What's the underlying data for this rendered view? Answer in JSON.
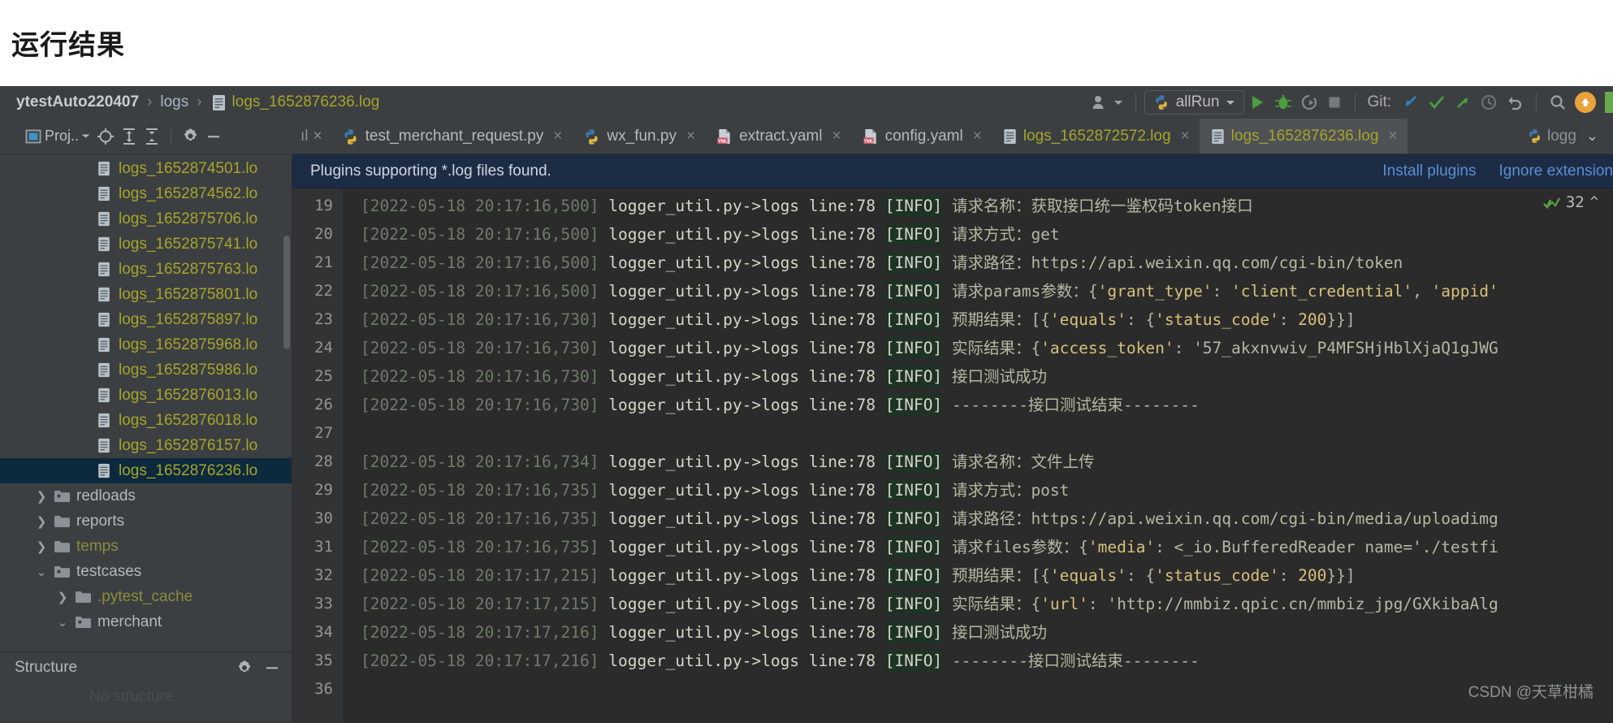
{
  "page": {
    "heading": "运行结果"
  },
  "breadcrumb": {
    "project": "ytestAuto220407",
    "folder": "logs",
    "file": "logs_1652876236.log",
    "separator": "›"
  },
  "toolbar": {
    "user_icon": "user-icon",
    "run_config": "allRun",
    "run_icon": "run-icon",
    "debug_icon": "debug-icon",
    "coverage_icon": "coverage-run-icon",
    "stop_icon": "stop-icon",
    "git_label": "Git:",
    "update_icon": "git-update-icon",
    "commit_icon": "git-commit-icon",
    "push_icon": "git-push-icon",
    "history_icon": "history-icon",
    "rollback_icon": "rollback-icon",
    "search_icon": "search-icon",
    "notification_icon": "update-available-icon"
  },
  "project_toolstrip": {
    "title": "Proj..",
    "dropdown_icon": "chevron-down-icon",
    "locate_icon": "locate-file-icon",
    "expand_icon": "expand-all-icon",
    "collapse_icon": "collapse-all-icon",
    "settings_icon": "gear-icon",
    "hide_icon": "minimize-icon"
  },
  "tabs": [
    {
      "label": "test_merchant_request.py",
      "icon": "python-file-icon",
      "kind": "py",
      "active": false,
      "closable": true
    },
    {
      "label": "wx_fun.py",
      "icon": "python-file-icon",
      "kind": "py",
      "active": false,
      "closable": true
    },
    {
      "label": "extract.yaml",
      "icon": "yaml-file-icon",
      "kind": "yaml",
      "active": false,
      "closable": true
    },
    {
      "label": "config.yaml",
      "icon": "yaml-file-icon",
      "kind": "yaml",
      "active": false,
      "closable": true
    },
    {
      "label": "logs_1652872572.log",
      "icon": "log-file-icon",
      "kind": "log",
      "active": false,
      "closable": true
    },
    {
      "label": "logs_1652876236.log",
      "icon": "log-file-icon",
      "kind": "log",
      "active": true,
      "closable": true
    }
  ],
  "tab_overflow": {
    "label": "logg",
    "icon": "python-file-icon",
    "chevron": "chevron-down-icon"
  },
  "sidebar": {
    "scrollbar": "tree-scrollbar",
    "items": [
      {
        "label": "logs_1652874501.lo",
        "type": "file",
        "indent": 3,
        "arrow": "",
        "icon": "log-file-icon",
        "selected": false
      },
      {
        "label": "logs_1652874562.lo",
        "type": "file",
        "indent": 3,
        "arrow": "",
        "icon": "log-file-icon",
        "selected": false
      },
      {
        "label": "logs_1652875706.lo",
        "type": "file",
        "indent": 3,
        "arrow": "",
        "icon": "log-file-icon",
        "selected": false
      },
      {
        "label": "logs_1652875741.lo",
        "type": "file",
        "indent": 3,
        "arrow": "",
        "icon": "log-file-icon",
        "selected": false
      },
      {
        "label": "logs_1652875763.lo",
        "type": "file",
        "indent": 3,
        "arrow": "",
        "icon": "log-file-icon",
        "selected": false
      },
      {
        "label": "logs_1652875801.lo",
        "type": "file",
        "indent": 3,
        "arrow": "",
        "icon": "log-file-icon",
        "selected": false
      },
      {
        "label": "logs_1652875897.lo",
        "type": "file",
        "indent": 3,
        "arrow": "",
        "icon": "log-file-icon",
        "selected": false
      },
      {
        "label": "logs_1652875968.lo",
        "type": "file",
        "indent": 3,
        "arrow": "",
        "icon": "log-file-icon",
        "selected": false
      },
      {
        "label": "logs_1652875986.lo",
        "type": "file",
        "indent": 3,
        "arrow": "",
        "icon": "log-file-icon",
        "selected": false
      },
      {
        "label": "logs_1652876013.lo",
        "type": "file",
        "indent": 3,
        "arrow": "",
        "icon": "log-file-icon",
        "selected": false
      },
      {
        "label": "logs_1652876018.lo",
        "type": "file",
        "indent": 3,
        "arrow": "",
        "icon": "log-file-icon",
        "selected": false
      },
      {
        "label": "logs_1652876157.lo",
        "type": "file",
        "indent": 3,
        "arrow": "",
        "icon": "log-file-icon",
        "selected": false
      },
      {
        "label": "logs_1652876236.lo",
        "type": "file",
        "indent": 3,
        "arrow": "",
        "icon": "log-file-icon",
        "selected": true
      },
      {
        "label": "redloads",
        "type": "folder-src",
        "indent": 1,
        "arrow": "›",
        "icon": "source-folder-icon",
        "selected": false
      },
      {
        "label": "reports",
        "type": "folder",
        "indent": 1,
        "arrow": "›",
        "icon": "folder-icon",
        "selected": false
      },
      {
        "label": "temps",
        "type": "folder-excluded",
        "indent": 1,
        "arrow": "›",
        "icon": "folder-icon",
        "selected": false
      },
      {
        "label": "testcases",
        "type": "folder-src",
        "indent": 1,
        "arrow": "⌄",
        "icon": "source-folder-icon",
        "selected": false
      },
      {
        "label": ".pytest_cache",
        "type": "folder-excluded",
        "indent": 2,
        "arrow": "›",
        "icon": "folder-icon",
        "selected": false
      },
      {
        "label": "merchant",
        "type": "folder-src",
        "indent": 2,
        "arrow": "⌄",
        "icon": "source-folder-icon",
        "selected": false
      }
    ]
  },
  "structure_panel": {
    "title": "Structure",
    "settings_icon": "gear-icon",
    "hide_icon": "minimize-icon"
  },
  "notification": {
    "message": "Plugins supporting *.log files found.",
    "link_install": "Install plugins",
    "link_ignore": "Ignore extension"
  },
  "inspection_widget": {
    "icon": "inspection-ok-icon",
    "count": "32",
    "caret": "^"
  },
  "watermark": "CSDN @天草柑橘",
  "editor": {
    "lines": [
      {
        "no": "19",
        "ts": "[2022-05-18 20:17:16,500]",
        "src": "logger_util.py->logs line:78",
        "lvl": "[INFO]",
        "msg": "请求名称：获取接口统一鉴权码token接口"
      },
      {
        "no": "20",
        "ts": "[2022-05-18 20:17:16,500]",
        "src": "logger_util.py->logs line:78",
        "lvl": "[INFO]",
        "msg": "请求方式：get"
      },
      {
        "no": "21",
        "ts": "[2022-05-18 20:17:16,500]",
        "src": "logger_util.py->logs line:78",
        "lvl": "[INFO]",
        "msg": "请求路径：https://api.weixin.qq.com/cgi-bin/token"
      },
      {
        "no": "22",
        "ts": "[2022-05-18 20:17:16,500]",
        "src": "logger_util.py->logs line:78",
        "lvl": "[INFO]",
        "msg": "请求params参数：{'grant_type': 'client_credential', 'appid'"
      },
      {
        "no": "23",
        "ts": "[2022-05-18 20:17:16,730]",
        "src": "logger_util.py->logs line:78",
        "lvl": "[INFO]",
        "msg": "预期结果：[{'equals': {'status_code': 200}}]"
      },
      {
        "no": "24",
        "ts": "[2022-05-18 20:17:16,730]",
        "src": "logger_util.py->logs line:78",
        "lvl": "[INFO]",
        "msg": "实际结果：{'access_token': '57_akxnvwiv_P4MFSHjHblXjaQ1gJWG"
      },
      {
        "no": "25",
        "ts": "[2022-05-18 20:17:16,730]",
        "src": "logger_util.py->logs line:78",
        "lvl": "[INFO]",
        "msg": "接口测试成功"
      },
      {
        "no": "26",
        "ts": "[2022-05-18 20:17:16,730]",
        "src": "logger_util.py->logs line:78",
        "lvl": "[INFO]",
        "msg": "--------接口测试结束--------"
      },
      {
        "no": "27",
        "ts": "",
        "src": "",
        "lvl": "",
        "msg": ""
      },
      {
        "no": "28",
        "ts": "[2022-05-18 20:17:16,734]",
        "src": "logger_util.py->logs line:78",
        "lvl": "[INFO]",
        "msg": "请求名称：文件上传"
      },
      {
        "no": "29",
        "ts": "[2022-05-18 20:17:16,735]",
        "src": "logger_util.py->logs line:78",
        "lvl": "[INFO]",
        "msg": "请求方式：post"
      },
      {
        "no": "30",
        "ts": "[2022-05-18 20:17:16,735]",
        "src": "logger_util.py->logs line:78",
        "lvl": "[INFO]",
        "msg": "请求路径：https://api.weixin.qq.com/cgi-bin/media/uploadimg"
      },
      {
        "no": "31",
        "ts": "[2022-05-18 20:17:16,735]",
        "src": "logger_util.py->logs line:78",
        "lvl": "[INFO]",
        "msg": "请求files参数：{'media': <_io.BufferedReader name='./testfi"
      },
      {
        "no": "32",
        "ts": "[2022-05-18 20:17:17,215]",
        "src": "logger_util.py->logs line:78",
        "lvl": "[INFO]",
        "msg": "预期结果：[{'equals': {'status_code': 200}}]"
      },
      {
        "no": "33",
        "ts": "[2022-05-18 20:17:17,215]",
        "src": "logger_util.py->logs line:78",
        "lvl": "[INFO]",
        "msg": "实际结果：{'url': 'http://mmbiz.qpic.cn/mmbiz_jpg/GXkibaAlg"
      },
      {
        "no": "34",
        "ts": "[2022-05-18 20:17:17,216]",
        "src": "logger_util.py->logs line:78",
        "lvl": "[INFO]",
        "msg": "接口测试成功"
      },
      {
        "no": "35",
        "ts": "[2022-05-18 20:17:17,216]",
        "src": "logger_util.py->logs line:78",
        "lvl": "[INFO]",
        "msg": "--------接口测试结束--------"
      },
      {
        "no": "36",
        "ts": "",
        "src": "",
        "lvl": "",
        "msg": ""
      }
    ]
  },
  "colors": {
    "ide_bg": "#2b2b2b",
    "panel_bg": "#3c3f41",
    "gutter_bg": "#313335",
    "selection_blue": "#0d293e",
    "log_yellow": "#a5a52a",
    "string_yellow": "#d7c07a",
    "notif_bg": "#1d2c45",
    "link_blue": "#5b8fd4",
    "accent_orange": "#e8a33d",
    "accent_green": "#6aa84f"
  }
}
